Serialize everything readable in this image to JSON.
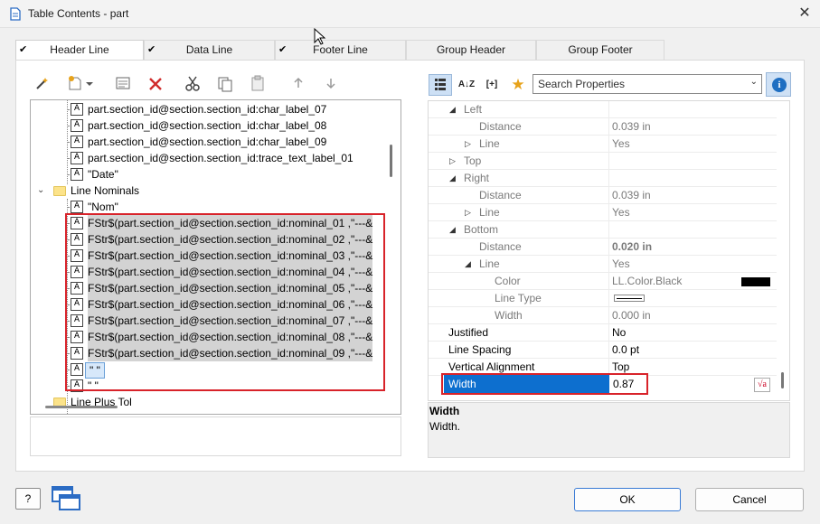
{
  "window": {
    "title": "Table Contents - part",
    "close_glyph": "✕"
  },
  "tabs": [
    {
      "label": "Header Line",
      "checked": true,
      "active": true
    },
    {
      "label": "Data Line",
      "checked": true,
      "active": false
    },
    {
      "label": "Footer Line",
      "checked": true,
      "active": false
    },
    {
      "label": "Group Header",
      "checked": false,
      "active": false
    },
    {
      "label": "Group Footer",
      "checked": false,
      "active": false
    }
  ],
  "check_glyph": "✔",
  "left_toolbar": {
    "icons": [
      "magic-wand-icon",
      "new-item-icon",
      "dropdown-arrow-icon",
      "properties-icon",
      "delete-icon",
      "cut-icon",
      "copy-icon",
      "paste-icon",
      "move-up-icon",
      "move-down-icon"
    ]
  },
  "tree": {
    "items": [
      {
        "label": "part.section_id@section.section_id:char_label_07",
        "selected": false
      },
      {
        "label": "part.section_id@section.section_id:char_label_08",
        "selected": false
      },
      {
        "label": "part.section_id@section.section_id:char_label_09",
        "selected": false
      },
      {
        "label": "part.section_id@section.section_id:trace_text_label_01",
        "selected": false
      },
      {
        "label": "\"Date\"",
        "selected": false
      }
    ],
    "group": {
      "label": "Line Nominals",
      "expand_glyph": "⌄"
    },
    "group_items": [
      {
        "label": "\"Nom\"",
        "selected": false
      },
      {
        "label": "FStr$(part.section_id@section.section_id:nominal_01 ,\"---&",
        "selected": true
      },
      {
        "label": "FStr$(part.section_id@section.section_id:nominal_02 ,\"---&",
        "selected": true
      },
      {
        "label": "FStr$(part.section_id@section.section_id:nominal_03 ,\"---&",
        "selected": true
      },
      {
        "label": "FStr$(part.section_id@section.section_id:nominal_04 ,\"---&",
        "selected": true
      },
      {
        "label": "FStr$(part.section_id@section.section_id:nominal_05 ,\"---&",
        "selected": true
      },
      {
        "label": "FStr$(part.section_id@section.section_id:nominal_06 ,\"---&",
        "selected": true
      },
      {
        "label": "FStr$(part.section_id@section.section_id:nominal_07 ,\"---&",
        "selected": true
      },
      {
        "label": "FStr$(part.section_id@section.section_id:nominal_08 ,\"---&",
        "selected": true
      },
      {
        "label": "FStr$(part.section_id@section.section_id:nominal_09 ,\"---&",
        "selected": true
      },
      {
        "label": "\" \"",
        "selected": false,
        "focused": true
      },
      {
        "label": "\" \"",
        "selected": false
      }
    ],
    "next_group_partial": "Line Plus Tol",
    "text_icon_glyph": "A"
  },
  "right_toolbar": {
    "az_glyph": "A↓Z",
    "expand_all_glyph": "[+]",
    "star_glyph": "★",
    "search_value": "Search Properties",
    "dropdown_glyph": "⌄",
    "info_glyph": "i"
  },
  "props": [
    {
      "name": "Left",
      "value": "",
      "twist": "◢",
      "indent": 1,
      "gray": true
    },
    {
      "name": "Distance",
      "value": "0.039 in",
      "twist": "",
      "indent": 2,
      "gray": true
    },
    {
      "name": "Line",
      "value": "Yes",
      "twist": "▷",
      "indent": 2,
      "gray": true
    },
    {
      "name": "Top",
      "value": "",
      "twist": "▷",
      "indent": 1,
      "gray": true
    },
    {
      "name": "Right",
      "value": "",
      "twist": "◢",
      "indent": 1,
      "gray": true
    },
    {
      "name": "Distance",
      "value": "0.039 in",
      "twist": "",
      "indent": 2,
      "gray": true
    },
    {
      "name": "Line",
      "value": "Yes",
      "twist": "▷",
      "indent": 2,
      "gray": true
    },
    {
      "name": "Bottom",
      "value": "",
      "twist": "◢",
      "indent": 1,
      "gray": true
    },
    {
      "name": "Distance",
      "value": "0.020 in",
      "twist": "",
      "indent": 2,
      "gray": true,
      "bold": true
    },
    {
      "name": "Line",
      "value": "Yes",
      "twist": "◢",
      "indent": 2,
      "gray": true
    },
    {
      "name": "Color",
      "value": "LL.Color.Black",
      "twist": "",
      "indent": 3,
      "gray": true,
      "swatch": "#000000"
    },
    {
      "name": "Line Type",
      "value": "",
      "twist": "",
      "indent": 3,
      "gray": true,
      "linesample": true
    },
    {
      "name": "Width",
      "value": "0.000 in",
      "twist": "",
      "indent": 3,
      "gray": true
    },
    {
      "name": "Justified",
      "value": "No",
      "twist": "",
      "indent": 0,
      "gray": false
    },
    {
      "name": "Line Spacing",
      "value": "0.0 pt",
      "twist": "",
      "indent": 0,
      "gray": false
    },
    {
      "name": "Vertical Alignment",
      "value": "Top",
      "twist": "",
      "indent": 0,
      "gray": false
    }
  ],
  "selected_prop": {
    "name": "Width",
    "value": "0.87",
    "formula_glyph": "√a"
  },
  "description": {
    "title": "Width",
    "body": "Width."
  },
  "footer": {
    "help_glyph": "?",
    "ok_label": "OK",
    "cancel_label": "Cancel"
  },
  "colors": {
    "accent": "#0d6fcf",
    "highlight_box": "#d8232a",
    "folder": "#fce38a"
  }
}
